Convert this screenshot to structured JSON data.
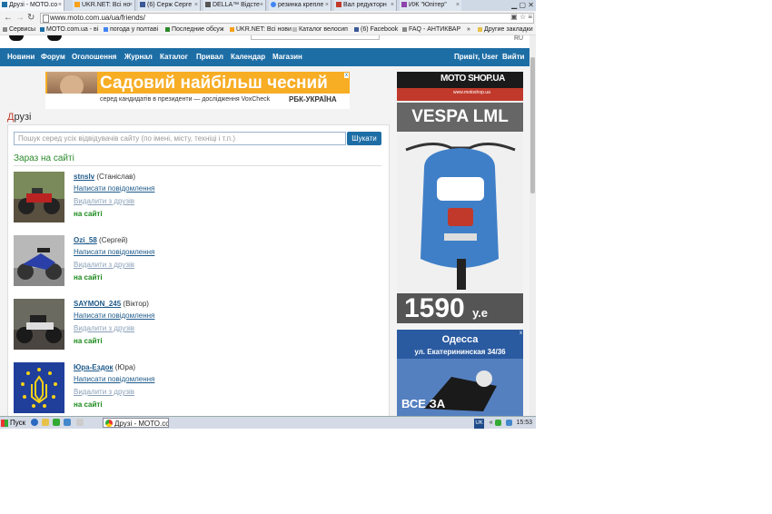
{
  "browser": {
    "tabs": [
      {
        "label": "Друзі - МОТО.со",
        "active": true
      },
      {
        "label": "UKR.NET: Всі но"
      },
      {
        "label": "(6) Серж Серге"
      },
      {
        "label": "DELLA™ Відсте"
      },
      {
        "label": "резинка крепле"
      },
      {
        "label": "Вал редукторн"
      },
      {
        "label": "ИЖ \"Юпітер\""
      }
    ],
    "url": "www.moto.com.ua/ua/friends/",
    "bookmarks": [
      "Сервисы",
      "MOTO.com.ua - ві",
      "погода у полтаві",
      "Последние обсуж",
      "UKR.NET: Всі нови",
      "Каталог велосип",
      "(6) Facebook",
      "FAQ - АНТИКВАР",
      "»",
      "Другие закладки"
    ]
  },
  "site": {
    "lang": "RU",
    "nav": [
      "Новини",
      "Форум",
      "Оголошення",
      "Журнал",
      "Каталог",
      "Привал",
      "Календар",
      "Магазин"
    ],
    "greeting": "Привіт, User",
    "logout": "Вийти"
  },
  "banner": {
    "title": "Садовий найбільш чесний",
    "subtitle": "серед кандидатів в президенти — дослідження VoxCheck",
    "brand": "РБК-УКРАЇНА",
    "close": "x"
  },
  "friends_page": {
    "heading_first": "Д",
    "heading_rest": "рузі",
    "search_placeholder": "Пошук серед усіх відвідувачів сайту (по імені, місту, техніці і т.п.)",
    "search_button": "Шукати",
    "online_heading": "Зараз на сайті",
    "friends": [
      {
        "username": "stnslv",
        "realname": "(Станіслав)",
        "message": "Написати повідомлення",
        "remove": "Видалити з друзів",
        "status": "на сайті"
      },
      {
        "username": "Ozi_58",
        "realname": "(Сергей)",
        "message": "Написати повідомлення",
        "remove": "Видалити з друзів",
        "status": "на сайті"
      },
      {
        "username": "SAYMON_245",
        "realname": "(Віктор)",
        "message": "Написати повідомлення",
        "remove": "Видалити з друзів",
        "status": "на сайті"
      },
      {
        "username": "Юра-Ездок",
        "realname": "(Юра)",
        "message": "Написати повідомлення",
        "remove": "Видалити з друзів",
        "status": "на сайті"
      }
    ]
  },
  "ads": {
    "moto": {
      "brand": "MOTO SHOP.UA",
      "site": "www.motoshop.ua",
      "model": "VESPA LML",
      "price": "1590",
      "currency": "у.е"
    },
    "odessa": {
      "city": "Одесса",
      "address": "ул. Екатерининская 34/36",
      "tagline": "ВСЕ ЗА",
      "close": "x"
    }
  },
  "taskbar": {
    "start": "Пуск",
    "task": "Друзі - МОТО.co...",
    "lang": "UK",
    "time": "15:53"
  }
}
